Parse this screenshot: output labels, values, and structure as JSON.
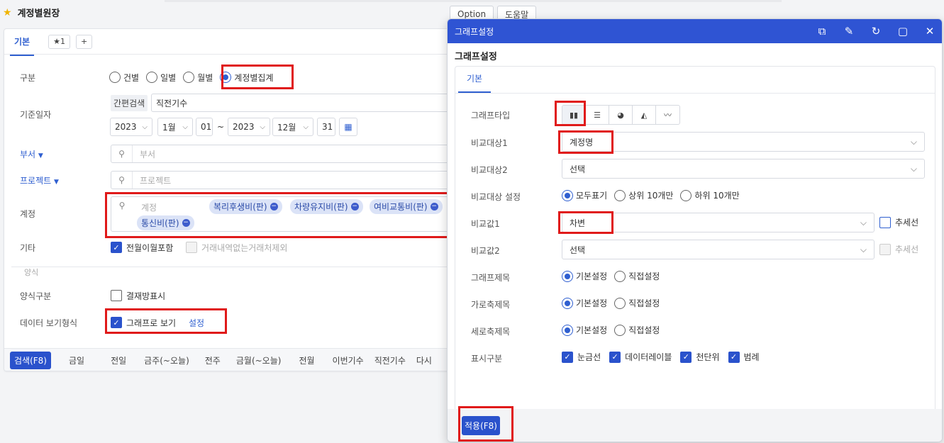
{
  "page": {
    "title": "계정별원장"
  },
  "tabs": {
    "main": "기본",
    "fav": "★1",
    "add": "+"
  },
  "top_buttons": {
    "option": "Option",
    "help": "도움말"
  },
  "form": {
    "gubun": {
      "label": "구분",
      "options": [
        "건별",
        "일별",
        "월별",
        "계정별집계"
      ],
      "selected": "계정별집계"
    },
    "base_date": {
      "label": "기준일자",
      "quick_label": "간편검색",
      "quick_value": "직전기수",
      "from_year": "2023",
      "from_month": "1월",
      "from_day": "01",
      "tilde": "~",
      "to_year": "2023",
      "to_month": "12월",
      "to_day": "31"
    },
    "dept": {
      "label": "부서",
      "placeholder": "부서"
    },
    "project": {
      "label": "프로젝트",
      "placeholder": "프로젝트"
    },
    "account": {
      "label": "계정",
      "placeholder": "계정",
      "chips": [
        "복리후생비(판)",
        "차량유지비(판)",
        "여비교통비(판)",
        "통신비(판)"
      ]
    },
    "etc": {
      "label": "기타",
      "opt1": "전월이월포함",
      "opt2": "거래내역없는거래처제외"
    },
    "section_label": "양식",
    "form_type": {
      "label": "양식구분",
      "opt": "결재방표시"
    },
    "data_view": {
      "label": "데이터 보기형식",
      "opt": "그래프로 보기",
      "link": "설정"
    }
  },
  "bottom_bar": {
    "search_btn": "검색(F8)",
    "items": [
      "금일",
      "전일",
      "금주(~오늘)",
      "전주",
      "금월(~오늘)",
      "전월",
      "이번기수",
      "직전기수",
      "다시"
    ]
  },
  "dialog": {
    "title": "그래프설정",
    "subtitle": "그래프설정",
    "tab": "기본",
    "graph_type": {
      "label": "그래프타입",
      "types": [
        "bar",
        "horizontal-bar",
        "pie",
        "area",
        "line"
      ],
      "selected": "bar"
    },
    "compare1": {
      "label": "비교대상1",
      "value": "계정명"
    },
    "compare2": {
      "label": "비교대상2",
      "value": "선택"
    },
    "compare_setting": {
      "label": "비교대상 설정",
      "options": [
        "모두표기",
        "상위 10개만",
        "하위 10개만"
      ],
      "selected": "모두표기"
    },
    "value1": {
      "label": "비교값1",
      "value": "차변",
      "trend": "추세선"
    },
    "value2": {
      "label": "비교값2",
      "value": "선택",
      "trend": "추세선"
    },
    "graph_title": {
      "label": "그래프제목",
      "options": [
        "기본설정",
        "직접설정"
      ],
      "selected": "기본설정"
    },
    "x_title": {
      "label": "가로축제목",
      "options": [
        "기본설정",
        "직접설정"
      ],
      "selected": "기본설정"
    },
    "y_title": {
      "label": "세로축제목",
      "options": [
        "기본설정",
        "직접설정"
      ],
      "selected": "기본설정"
    },
    "display": {
      "label": "표시구분",
      "options": [
        "눈금선",
        "데이터레이블",
        "천단위",
        "범례"
      ]
    },
    "apply_btn": "적용(F8)"
  }
}
